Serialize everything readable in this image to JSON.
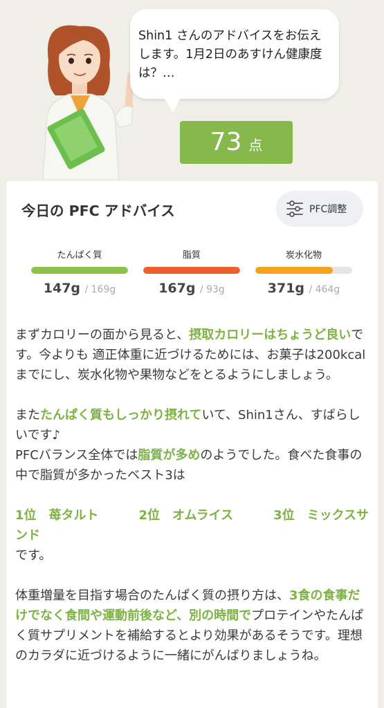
{
  "bubble": {
    "message": "Shin1 さんのアドバイスをお伝えします。1月2日のあすけん健康度は？…"
  },
  "score": {
    "value": "73",
    "unit": "点"
  },
  "card": {
    "title": "今日の PFC アドバイス",
    "pfc_button": "PFC調整"
  },
  "nutrients": [
    {
      "label": "たんぱく質",
      "value": "147g",
      "target": " / 169g",
      "progress": 1.0,
      "color": "#8bc34a"
    },
    {
      "label": "脂質",
      "value": "167g",
      "target": " / 93g",
      "progress": 1.0,
      "color": "#ee5f2c"
    },
    {
      "label": "炭水化物",
      "value": "371g",
      "target": " / 464g",
      "progress": 0.8,
      "color": "#f5a21d"
    }
  ],
  "advice": {
    "p1_a": "まずカロリーの面から見ると、",
    "p1_hl": "摂取カロリーはちょうど良い",
    "p1_b": "です。今よりも 適正体重に近づけるためには、お菓子は200kcalまでにし、炭水化物や果物などをとるようにしましょう。",
    "p2_a": "また",
    "p2_hl": "たんぱく質もしっかり摂れて",
    "p2_b": "いて、Shin1さん、すばらしいです♪",
    "p3_a": "PFCバランス全体では",
    "p3_hl": "脂質が多め",
    "p3_b": "のようでした。食べた食事の中で脂質が多かったベスト3は",
    "rank1": "1位　苺タルト",
    "rank2": "2位　オムライス",
    "rank3": "3位　ミックスサンド",
    "rank_tail": "です。",
    "p4_a": "体重増量を目指す場合のたんぱく質の摂り方は、",
    "p4_hl": "3食の食事だけでなく食間や運動前後など、別の時間で",
    "p4_b": "プロテインやたんぱく質サプリメントを補給するとより効果があるそうです。理想のカラダに近づけるように一緒にがんばりましょうね。"
  }
}
